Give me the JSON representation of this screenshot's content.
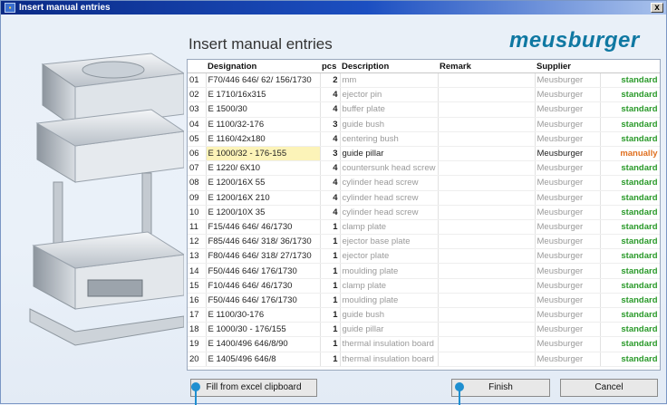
{
  "window": {
    "title": "Insert manual entries",
    "close_label": "x"
  },
  "heading": "Insert manual entries",
  "logo": "meusburger",
  "table": {
    "columns": [
      "Designation",
      "pcs",
      "Description",
      "Remark",
      "Supplier",
      ""
    ],
    "rows": [
      {
        "num": "01",
        "designation": "F70/446 646/ 62/ 156/1730",
        "pcs": "2",
        "description": "mm",
        "remark": "",
        "supplier": "Meusburger",
        "status": "standard"
      },
      {
        "num": "02",
        "designation": "E 1710/16x315",
        "pcs": "4",
        "description": "ejector pin",
        "remark": "",
        "supplier": "Meusburger",
        "status": "standard"
      },
      {
        "num": "03",
        "designation": "E 1500/30",
        "pcs": "4",
        "description": "buffer plate",
        "remark": "",
        "supplier": "Meusburger",
        "status": "standard"
      },
      {
        "num": "04",
        "designation": "E 1100/32-176",
        "pcs": "3",
        "description": "guide bush",
        "remark": "",
        "supplier": "Meusburger",
        "status": "standard"
      },
      {
        "num": "05",
        "designation": "E 1160/42x180",
        "pcs": "4",
        "description": "centering bush",
        "remark": "",
        "supplier": "Meusburger",
        "status": "standard"
      },
      {
        "num": "06",
        "designation": "E 1000/32 - 176-155",
        "pcs": "3",
        "description": "guide pillar",
        "remark": "",
        "supplier": "Meusburger",
        "status": "manually"
      },
      {
        "num": "07",
        "designation": "E 1220/ 6X10",
        "pcs": "4",
        "description": "countersunk head screw",
        "remark": "",
        "supplier": "Meusburger",
        "status": "standard"
      },
      {
        "num": "08",
        "designation": "E 1200/16X 55",
        "pcs": "4",
        "description": "cylinder head screw",
        "remark": "",
        "supplier": "Meusburger",
        "status": "standard"
      },
      {
        "num": "09",
        "designation": "E 1200/16X 210",
        "pcs": "4",
        "description": "cylinder head screw",
        "remark": "",
        "supplier": "Meusburger",
        "status": "standard"
      },
      {
        "num": "10",
        "designation": "E 1200/10X 35",
        "pcs": "4",
        "description": "cylinder head screw",
        "remark": "",
        "supplier": "Meusburger",
        "status": "standard"
      },
      {
        "num": "11",
        "designation": "F15/446 646/ 46/1730",
        "pcs": "1",
        "description": "clamp plate",
        "remark": "",
        "supplier": "Meusburger",
        "status": "standard"
      },
      {
        "num": "12",
        "designation": "F85/446 646/ 318/ 36/1730",
        "pcs": "1",
        "description": "ejector base plate",
        "remark": "",
        "supplier": "Meusburger",
        "status": "standard"
      },
      {
        "num": "13",
        "designation": "F80/446 646/ 318/ 27/1730",
        "pcs": "1",
        "description": "ejector plate",
        "remark": "",
        "supplier": "Meusburger",
        "status": "standard"
      },
      {
        "num": "14",
        "designation": "F50/446 646/ 176/1730",
        "pcs": "1",
        "description": "moulding plate",
        "remark": "",
        "supplier": "Meusburger",
        "status": "standard"
      },
      {
        "num": "15",
        "designation": "F10/446 646/ 46/1730",
        "pcs": "1",
        "description": "clamp plate",
        "remark": "",
        "supplier": "Meusburger",
        "status": "standard"
      },
      {
        "num": "16",
        "designation": "F50/446 646/ 176/1730",
        "pcs": "1",
        "description": "moulding plate",
        "remark": "",
        "supplier": "Meusburger",
        "status": "standard"
      },
      {
        "num": "17",
        "designation": "E 1100/30-176",
        "pcs": "1",
        "description": "guide bush",
        "remark": "",
        "supplier": "Meusburger",
        "status": "standard"
      },
      {
        "num": "18",
        "designation": "E 1000/30 - 176/155",
        "pcs": "1",
        "description": "guide pillar",
        "remark": "",
        "supplier": "Meusburger",
        "status": "standard"
      },
      {
        "num": "19",
        "designation": "E 1400/496 646/8/90",
        "pcs": "1",
        "description": "thermal insulation board",
        "remark": "",
        "supplier": "Meusburger",
        "status": "standard"
      },
      {
        "num": "20",
        "designation": "E 1405/496 646/8",
        "pcs": "1",
        "description": "thermal insulation board",
        "remark": "",
        "supplier": "Meusburger",
        "status": "standard"
      }
    ]
  },
  "buttons": {
    "excel": "Fill from excel clipboard",
    "finish": "Finish",
    "cancel": "Cancel"
  }
}
